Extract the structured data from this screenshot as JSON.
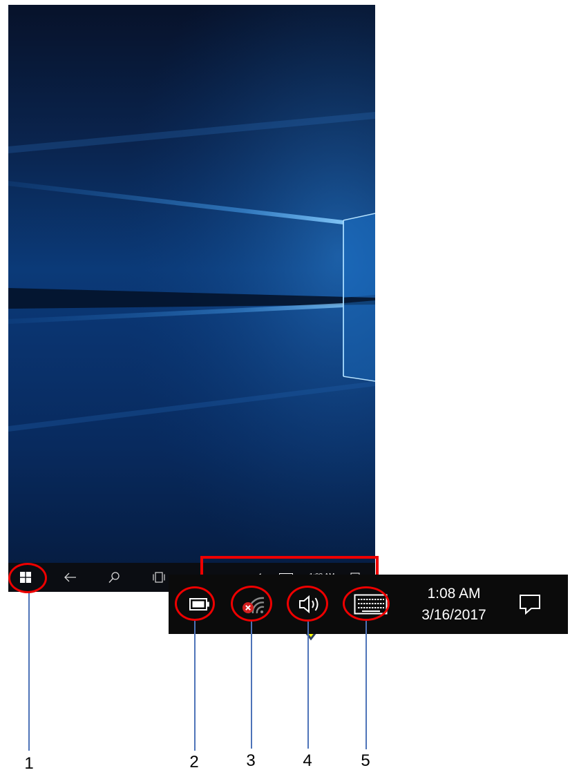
{
  "taskbar": {
    "items": [
      "start-button",
      "back-button",
      "search-button",
      "task-view-button"
    ],
    "tray": {
      "time": "1:08 AM",
      "date": "3/16/2017",
      "icons": [
        "battery-icon",
        "wifi-disconnected-icon",
        "volume-icon",
        "touch-keyboard-icon",
        "action-center-icon"
      ]
    }
  },
  "annotations": {
    "labels": [
      "1",
      "2",
      "3",
      "4",
      "5"
    ]
  },
  "colors": {
    "taskbar": "#0b0d12",
    "highlight": "#ee0000",
    "arrow_fill": "#ffff00",
    "arrow_stroke": "#2f3f5f",
    "leader_line": "#4d73b8"
  }
}
